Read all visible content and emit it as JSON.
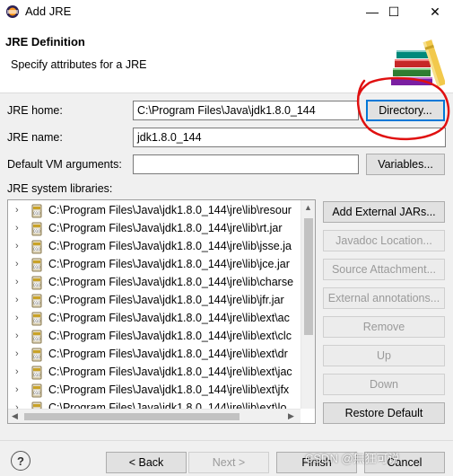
{
  "window": {
    "title": "Add JRE",
    "minimize_glyph": "—",
    "maximize_glyph": "☐",
    "close_glyph": "✕"
  },
  "header": {
    "title": "JRE Definition",
    "subtitle": "Specify attributes for a JRE",
    "banner_icon": "books-icon"
  },
  "form": {
    "jre_home_label": "JRE home:",
    "jre_home_value": "C:\\Program Files\\Java\\jdk1.8.0_144",
    "directory_button": "Directory...",
    "jre_name_label": "JRE name:",
    "jre_name_value": "jdk1.8.0_144",
    "vm_args_label": "Default VM arguments:",
    "vm_args_value": "",
    "variables_button": "Variables...",
    "libraries_label": "JRE system libraries:"
  },
  "libraries": [
    "C:\\Program Files\\Java\\jdk1.8.0_144\\jre\\lib\\resour",
    "C:\\Program Files\\Java\\jdk1.8.0_144\\jre\\lib\\rt.jar",
    "C:\\Program Files\\Java\\jdk1.8.0_144\\jre\\lib\\jsse.ja",
    "C:\\Program Files\\Java\\jdk1.8.0_144\\jre\\lib\\jce.jar",
    "C:\\Program Files\\Java\\jdk1.8.0_144\\jre\\lib\\charse",
    "C:\\Program Files\\Java\\jdk1.8.0_144\\jre\\lib\\jfr.jar",
    "C:\\Program Files\\Java\\jdk1.8.0_144\\jre\\lib\\ext\\ac",
    "C:\\Program Files\\Java\\jdk1.8.0_144\\jre\\lib\\ext\\clc",
    "C:\\Program Files\\Java\\jdk1.8.0_144\\jre\\lib\\ext\\dr",
    "C:\\Program Files\\Java\\jdk1.8.0_144\\jre\\lib\\ext\\jac",
    "C:\\Program Files\\Java\\jdk1.8.0_144\\jre\\lib\\ext\\jfx",
    "C:\\Program Files\\Java\\jdk1.8.0_144\\jre\\lib\\ext\\lo"
  ],
  "side_buttons": {
    "add_external_jars": "Add External JARs...",
    "javadoc_location": "Javadoc Location...",
    "source_attachment": "Source Attachment...",
    "external_annotations": "External annotations...",
    "remove": "Remove",
    "up": "Up",
    "down": "Down",
    "restore_default": "Restore Default"
  },
  "footer": {
    "help_glyph": "?",
    "back": "< Back",
    "next": "Next >",
    "finish": "Finish",
    "cancel": "Cancel"
  },
  "watermark": "CSDN @無狂可说",
  "colors": {
    "annotation": "#e01010",
    "focus": "#0078d7"
  }
}
